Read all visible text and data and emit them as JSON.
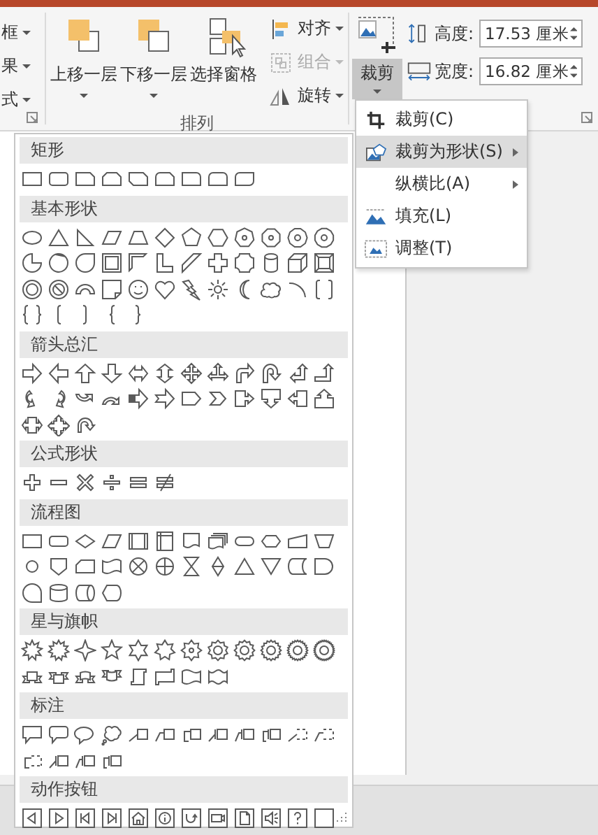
{
  "ribbon": {
    "left_group": {
      "items": [
        {
          "label": "框"
        },
        {
          "label": "果"
        },
        {
          "label": "式"
        }
      ]
    },
    "arrange_group": {
      "label": "排列",
      "large_buttons": [
        {
          "label": "上移一层",
          "kind": "bring-forward",
          "dropdown": true
        },
        {
          "label": "下移一层",
          "kind": "send-backward",
          "dropdown": true
        },
        {
          "label": "选择窗格",
          "kind": "selection-pane",
          "dropdown": false
        }
      ],
      "small_buttons": [
        {
          "label": "对齐",
          "kind": "align",
          "disabled": false
        },
        {
          "label": "组合",
          "kind": "group",
          "disabled": true
        },
        {
          "label": "旋转",
          "kind": "rotate",
          "disabled": false
        }
      ]
    },
    "size_group": {
      "crop_button": {
        "label": "裁剪",
        "selected": true
      },
      "fields": [
        {
          "kind": "height",
          "label": "高度:",
          "value": "17.53 厘米"
        },
        {
          "kind": "width",
          "label": "宽度:",
          "value": "16.82 厘米"
        }
      ]
    }
  },
  "crop_menu": [
    {
      "label": "裁剪(C)",
      "kind": "crop",
      "selected": false,
      "submenu": false
    },
    {
      "label": "裁剪为形状(S)",
      "kind": "crop-to-shape",
      "selected": true,
      "submenu": true
    },
    {
      "label": "纵横比(A)",
      "kind": "aspect-ratio",
      "selected": false,
      "submenu": true
    },
    {
      "label": "填充(L)",
      "kind": "fill",
      "selected": false,
      "submenu": false
    },
    {
      "label": "调整(T)",
      "kind": "fit",
      "selected": false,
      "submenu": false
    }
  ],
  "shape_gallery": [
    {
      "title": "矩形",
      "shapes": [
        {
          "kind": "rect"
        },
        {
          "kind": "round-rect"
        },
        {
          "kind": "snip-corner-rect"
        },
        {
          "kind": "snip-same-side-rect"
        },
        {
          "kind": "snip-diagonal-rect"
        },
        {
          "kind": "snip-round-rect"
        },
        {
          "kind": "round-corner-rect"
        },
        {
          "kind": "round-same-side-rect"
        },
        {
          "kind": "round-diagonal-rect"
        }
      ]
    },
    {
      "title": "基本形状",
      "shapes": [
        {
          "kind": "oval"
        },
        {
          "kind": "triangle"
        },
        {
          "kind": "right-triangle"
        },
        {
          "kind": "parallelogram"
        },
        {
          "kind": "trapezoid"
        },
        {
          "kind": "diamond"
        },
        {
          "kind": "pentagon"
        },
        {
          "kind": "hexagon"
        },
        {
          "kind": "heptagon"
        },
        {
          "kind": "octagon"
        },
        {
          "kind": "decagon"
        },
        {
          "kind": "dodecagon"
        },
        {
          "kind": "pie"
        },
        {
          "kind": "chord"
        },
        {
          "kind": "teardrop"
        },
        {
          "kind": "frame"
        },
        {
          "kind": "half-frame"
        },
        {
          "kind": "l-shape"
        },
        {
          "kind": "diagonal-stripe"
        },
        {
          "kind": "cross"
        },
        {
          "kind": "plaque"
        },
        {
          "kind": "can"
        },
        {
          "kind": "cube"
        },
        {
          "kind": "bevel"
        },
        {
          "kind": "donut"
        },
        {
          "kind": "no-symbol"
        },
        {
          "kind": "block-arc"
        },
        {
          "kind": "folded-corner"
        },
        {
          "kind": "smiley"
        },
        {
          "kind": "heart"
        },
        {
          "kind": "lightning"
        },
        {
          "kind": "sun"
        },
        {
          "kind": "moon"
        },
        {
          "kind": "cloud"
        },
        {
          "kind": "arc"
        },
        {
          "kind": "double-bracket"
        },
        {
          "kind": "double-brace"
        },
        {
          "kind": "left-bracket"
        },
        {
          "kind": "right-bracket"
        },
        {
          "kind": "left-brace"
        },
        {
          "kind": "right-brace"
        }
      ]
    },
    {
      "title": "箭头总汇",
      "shapes": [
        {
          "kind": "right-arrow"
        },
        {
          "kind": "left-arrow"
        },
        {
          "kind": "up-arrow"
        },
        {
          "kind": "down-arrow"
        },
        {
          "kind": "left-right-arrow"
        },
        {
          "kind": "up-down-arrow"
        },
        {
          "kind": "quad-arrow"
        },
        {
          "kind": "left-right-up-arrow"
        },
        {
          "kind": "bent-arrow"
        },
        {
          "kind": "u-turn-arrow"
        },
        {
          "kind": "left-up-arrow"
        },
        {
          "kind": "bent-up-arrow"
        },
        {
          "kind": "curved-right-arrow"
        },
        {
          "kind": "curved-left-arrow"
        },
        {
          "kind": "curved-up-arrow"
        },
        {
          "kind": "curved-down-arrow"
        },
        {
          "kind": "striped-right-arrow"
        },
        {
          "kind": "notched-right-arrow"
        },
        {
          "kind": "pentagon-arrow"
        },
        {
          "kind": "chevron"
        },
        {
          "kind": "right-arrow-callout"
        },
        {
          "kind": "down-arrow-callout"
        },
        {
          "kind": "left-arrow-callout"
        },
        {
          "kind": "up-arrow-callout"
        },
        {
          "kind": "left-right-arrow-callout"
        },
        {
          "kind": "quad-arrow-callout"
        },
        {
          "kind": "circular-arrow"
        }
      ]
    },
    {
      "title": "公式形状",
      "shapes": [
        {
          "kind": "plus"
        },
        {
          "kind": "minus"
        },
        {
          "kind": "multiply"
        },
        {
          "kind": "divide"
        },
        {
          "kind": "equal"
        },
        {
          "kind": "not-equal"
        }
      ]
    },
    {
      "title": "流程图",
      "shapes": [
        {
          "kind": "process"
        },
        {
          "kind": "alternate-process"
        },
        {
          "kind": "decision"
        },
        {
          "kind": "data"
        },
        {
          "kind": "predefined-process"
        },
        {
          "kind": "internal-storage"
        },
        {
          "kind": "document"
        },
        {
          "kind": "multidocument"
        },
        {
          "kind": "terminator"
        },
        {
          "kind": "preparation"
        },
        {
          "kind": "manual-input"
        },
        {
          "kind": "manual-operation"
        },
        {
          "kind": "connector"
        },
        {
          "kind": "off-page-connector"
        },
        {
          "kind": "card"
        },
        {
          "kind": "punched-tape"
        },
        {
          "kind": "summing-junction"
        },
        {
          "kind": "or"
        },
        {
          "kind": "collate"
        },
        {
          "kind": "sort"
        },
        {
          "kind": "extract"
        },
        {
          "kind": "merge"
        },
        {
          "kind": "stored-data"
        },
        {
          "kind": "delay"
        },
        {
          "kind": "sequential-access"
        },
        {
          "kind": "magnetic-disk"
        },
        {
          "kind": "direct-access"
        },
        {
          "kind": "display"
        }
      ]
    },
    {
      "title": "星与旗帜",
      "shapes": [
        {
          "kind": "explosion-1"
        },
        {
          "kind": "explosion-2"
        },
        {
          "kind": "star-4"
        },
        {
          "kind": "star-5"
        },
        {
          "kind": "star-6"
        },
        {
          "kind": "star-7"
        },
        {
          "kind": "star-8"
        },
        {
          "kind": "star-10"
        },
        {
          "kind": "star-12"
        },
        {
          "kind": "star-16"
        },
        {
          "kind": "star-24"
        },
        {
          "kind": "star-32"
        },
        {
          "kind": "ribbon-up"
        },
        {
          "kind": "ribbon-down"
        },
        {
          "kind": "curved-ribbon-up"
        },
        {
          "kind": "curved-ribbon-down"
        },
        {
          "kind": "vertical-scroll"
        },
        {
          "kind": "horizontal-scroll"
        },
        {
          "kind": "wave"
        },
        {
          "kind": "double-wave"
        }
      ]
    },
    {
      "title": "标注",
      "shapes": [
        {
          "kind": "rect-callout"
        },
        {
          "kind": "round-rect-callout"
        },
        {
          "kind": "oval-callout"
        },
        {
          "kind": "cloud-callout"
        },
        {
          "kind": "line-callout-1"
        },
        {
          "kind": "line-callout-2"
        },
        {
          "kind": "line-callout-3"
        },
        {
          "kind": "accent-callout-1"
        },
        {
          "kind": "accent-callout-2"
        },
        {
          "kind": "accent-callout-3"
        },
        {
          "kind": "plain-callout-1"
        },
        {
          "kind": "plain-callout-2"
        },
        {
          "kind": "plain-callout-3"
        },
        {
          "kind": "border-accent-callout-1"
        },
        {
          "kind": "border-accent-callout-2"
        },
        {
          "kind": "border-accent-callout-3"
        }
      ]
    },
    {
      "title": "动作按钮",
      "shapes": [
        {
          "kind": "back-button"
        },
        {
          "kind": "forward-button"
        },
        {
          "kind": "beginning-button"
        },
        {
          "kind": "end-button"
        },
        {
          "kind": "home-button"
        },
        {
          "kind": "information-button"
        },
        {
          "kind": "return-button"
        },
        {
          "kind": "movie-button"
        },
        {
          "kind": "document-button"
        },
        {
          "kind": "sound-button"
        },
        {
          "kind": "help-button"
        },
        {
          "kind": "custom-button"
        }
      ]
    }
  ]
}
